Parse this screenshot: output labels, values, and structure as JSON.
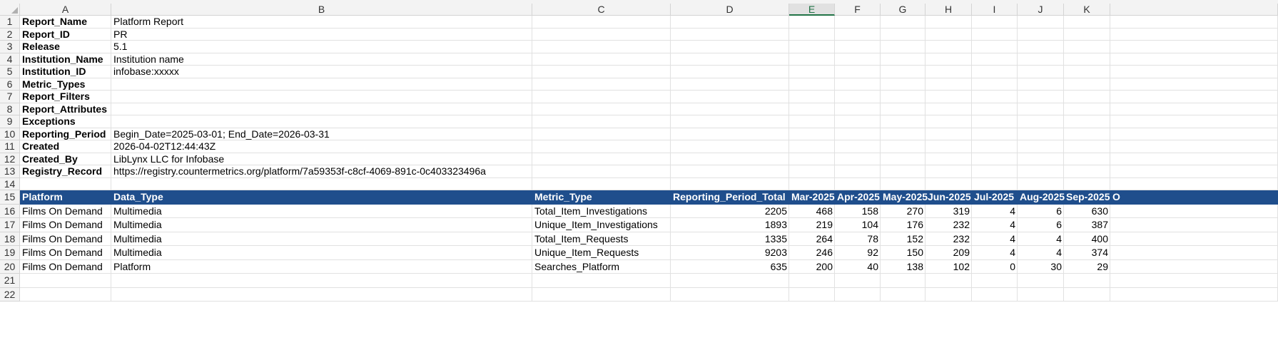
{
  "columns": [
    "A",
    "B",
    "C",
    "D",
    "E",
    "F",
    "G",
    "H",
    "I",
    "J",
    "K"
  ],
  "selected_column": "E",
  "row_numbers": [
    "1",
    "2",
    "3",
    "4",
    "5",
    "6",
    "7",
    "8",
    "9",
    "10",
    "11",
    "12",
    "13",
    "14",
    "15",
    "16",
    "17",
    "18",
    "19",
    "20",
    "21",
    "22"
  ],
  "header_rows": [
    {
      "label": "Report_Name",
      "value": "Platform Report"
    },
    {
      "label": "Report_ID",
      "value": "PR"
    },
    {
      "label": "Release",
      "value": "5.1"
    },
    {
      "label": "Institution_Name",
      "value": "Institution name"
    },
    {
      "label": "Institution_ID",
      "value": "infobase:xxxxx"
    },
    {
      "label": "Metric_Types",
      "value": ""
    },
    {
      "label": "Report_Filters",
      "value": ""
    },
    {
      "label": "Report_Attributes",
      "value": ""
    },
    {
      "label": "Exceptions",
      "value": ""
    },
    {
      "label": "Reporting_Period",
      "value": "Begin_Date=2025-03-01; End_Date=2026-03-31"
    },
    {
      "label": "Created",
      "value": "2026-04-02T12:44:43Z"
    },
    {
      "label": "Created_By",
      "value": "LibLynx LLC for Infobase"
    },
    {
      "label": "Registry_Record",
      "value": "https://registry.countermetrics.org/platform/7a59353f-c8cf-4069-891c-0c403323496a"
    }
  ],
  "table_headers": [
    "Platform",
    "Data_Type",
    "Metric_Type",
    "Reporting_Period_Total",
    "Mar-2025",
    "Apr-2025",
    "May-2025",
    "Jun-2025",
    "Jul-2025",
    "Aug-2025",
    "Sep-2025",
    "O"
  ],
  "table_rows": [
    [
      "Films On Demand",
      "Multimedia",
      "Total_Item_Investigations",
      "2205",
      "468",
      "158",
      "270",
      "319",
      "4",
      "6",
      "630"
    ],
    [
      "Films On Demand",
      "Multimedia",
      "Unique_Item_Investigations",
      "1893",
      "219",
      "104",
      "176",
      "232",
      "4",
      "6",
      "387"
    ],
    [
      "Films On Demand",
      "Multimedia",
      "Total_Item_Requests",
      "1335",
      "264",
      "78",
      "152",
      "232",
      "4",
      "4",
      "400"
    ],
    [
      "Films On Demand",
      "Multimedia",
      "Unique_Item_Requests",
      "9203",
      "246",
      "92",
      "150",
      "209",
      "4",
      "4",
      "374"
    ],
    [
      "Films On Demand",
      "Platform",
      "Searches_Platform",
      "635",
      "200",
      "40",
      "138",
      "102",
      "0",
      "30",
      "29"
    ]
  ],
  "colors": {
    "header_fill": "#1f4e8c",
    "header_text": "#ffffff",
    "selected_col": "#217346"
  }
}
